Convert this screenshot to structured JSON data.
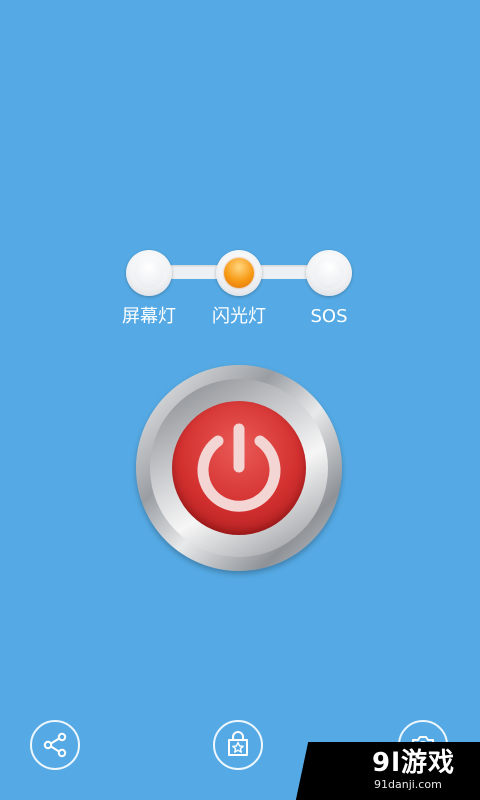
{
  "modes": [
    {
      "label": "屏幕灯",
      "active": false
    },
    {
      "label": "闪光灯",
      "active": true
    },
    {
      "label": "SOS",
      "active": false
    }
  ],
  "colors": {
    "background": "#55aae5",
    "active_mode": "#f79a15",
    "power_red": "#d2302f"
  },
  "power_button": {
    "icon": "power-icon"
  },
  "bottom_buttons": [
    {
      "name": "share",
      "icon": "share-icon"
    },
    {
      "name": "store",
      "icon": "shopping-bag-star-icon"
    },
    {
      "name": "camera",
      "icon": "camera-icon"
    }
  ],
  "watermark": {
    "main": "9l游戏",
    "sub": "91danji.com"
  }
}
